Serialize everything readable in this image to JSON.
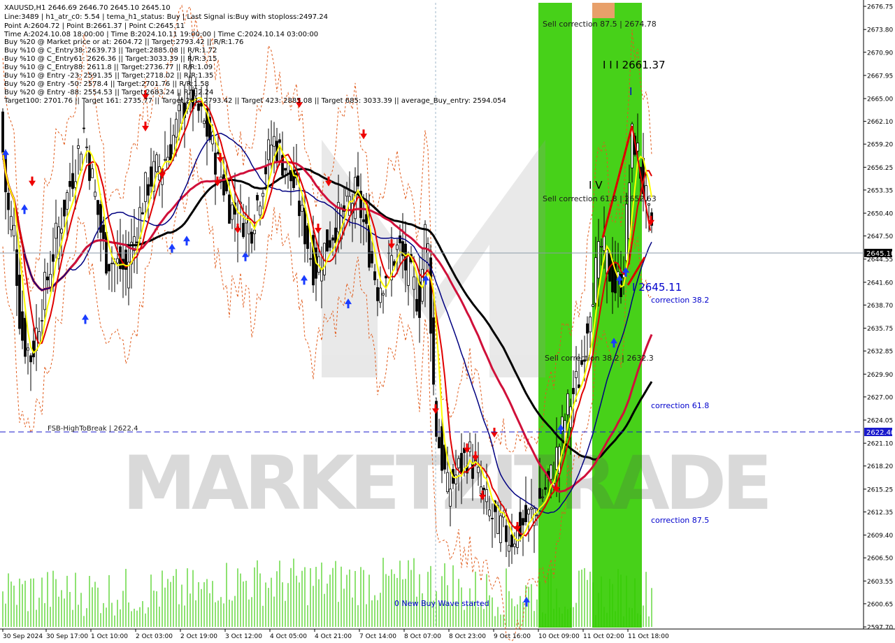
{
  "header": {
    "symbol_line": "XAUUSD,H1  2646.69 2646.70 2645.10 2645.10",
    "info_lines": [
      "Line:3489 | h1_atr_c0: 5.54 | tema_h1_status: Buy | Last Signal is:Buy with stoploss:2497.24",
      "Point A:2604.72 | Point B:2661.37 | Point C:2645.11",
      "Time A:2024.10.08 18:00:00 | Time B:2024.10.11 19:00:00 | Time C:2024.10.14 03:00:00",
      "Buy %20 @ Market price or at: 2604.72 || Target:2793.42 || R/R:1.76",
      "Buy %10 @ C_Entry38: 2639.73 || Target:2885.08 || R/R:1.72",
      "Buy %10 @ C_Entry61: 2626.36 || Target:3033.39 || R/R:3.15",
      "Buy %10 @ C_Entry88: 2611.8 || Target:2736.77 || R/R:1.09",
      "Buy %10 @ Entry -23: 2591.35 || Target:2718.02 || R/R:1.35",
      "Buy %20 @ Entry -50: 2578.4 || Target:2701.76 || R/R:1.58",
      "Buy %20 @ Entry -88: 2554.53 || Target:2683.24 || R/R:2.24",
      "Target100: 2701.76 || Target 161: 2735.77 || Target 261: 2793.42 || Target 423: 2885.08 || Target 685: 3033.39 || average_Buy_entry: 2594.054"
    ]
  },
  "watermark": "MARKETZITRADE",
  "annotations": {
    "sell_875": "Sell correction 87.5 | 2674.78",
    "sell_618": "Sell correction 61.8 | 2652.63",
    "sell_382": "Sell correction 38.2 | 2632.3",
    "point_b": "I I I 2661.37",
    "point_c": "I 2645.11",
    "wave_iv": "I V",
    "wave_i": "I",
    "corr_382": "correction 38.2",
    "corr_618": "correction 61.8",
    "corr_875": "correction 87.5",
    "fsb": "FSB-HighToBreak | 2622.4",
    "new_wave": "0 New Buy Wave started"
  },
  "price_tags": {
    "current": "2645.10",
    "fsb": "2622.40"
  },
  "colors": {
    "green_zone": "#33cc00",
    "orange_box": "#e8a06a",
    "blue_label": "#0000cc",
    "current_tag": "#000000",
    "fsb_tag": "#1a1acc",
    "ma_black": "#000000",
    "ma_crimson": "#d0103a",
    "ma_navy": "#000080",
    "ma_red": "#e00000",
    "ma_yellow": "#ffff00",
    "volume": "#33cc00"
  },
  "chart_data": {
    "type": "candlestick",
    "symbol": "XAUUSD",
    "timeframe": "H1",
    "ylim": [
      2597.7,
      2677.2
    ],
    "y_ticks": [
      "2676.75",
      "2673.80",
      "2670.90",
      "2667.95",
      "2665.00",
      "2662.10",
      "2659.20",
      "2656.25",
      "2653.35",
      "2650.40",
      "2647.50",
      "2644.55",
      "2641.60",
      "2638.70",
      "2635.75",
      "2632.85",
      "2629.90",
      "2627.00",
      "2624.05",
      "2621.10",
      "2618.20",
      "2615.25",
      "2612.35",
      "2609.40",
      "2606.50",
      "2603.55",
      "2600.65",
      "2597.70"
    ],
    "x_ticks": [
      "30 Sep 2024",
      "30 Sep 17:00",
      "1 Oct 10:00",
      "2 Oct 03:00",
      "2 Oct 19:00",
      "3 Oct 12:00",
      "4 Oct 05:00",
      "4 Oct 21:00",
      "7 Oct 14:00",
      "8 Oct 07:00",
      "8 Oct 23:00",
      "9 Oct 16:00",
      "10 Oct 09:00",
      "11 Oct 02:00",
      "11 Oct 18:00"
    ],
    "close_anchors": [
      [
        0,
        2663
      ],
      [
        10,
        2651
      ],
      [
        20,
        2648
      ],
      [
        30,
        2635
      ],
      [
        45,
        2632
      ],
      [
        60,
        2639
      ],
      [
        80,
        2647
      ],
      [
        100,
        2654
      ],
      [
        120,
        2661
      ],
      [
        150,
        2645
      ],
      [
        180,
        2643
      ],
      [
        210,
        2654
      ],
      [
        240,
        2658
      ],
      [
        270,
        2666
      ],
      [
        300,
        2660
      ],
      [
        330,
        2651
      ],
      [
        360,
        2649
      ],
      [
        390,
        2660
      ],
      [
        420,
        2654
      ],
      [
        450,
        2643
      ],
      [
        480,
        2649
      ],
      [
        510,
        2653
      ],
      [
        540,
        2641
      ],
      [
        570,
        2646
      ],
      [
        600,
        2639
      ],
      [
        610,
        2650
      ],
      [
        622,
        2624
      ],
      [
        640,
        2615
      ],
      [
        670,
        2620
      ],
      [
        700,
        2612
      ],
      [
        730,
        2609
      ],
      [
        760,
        2612
      ],
      [
        790,
        2617
      ],
      [
        810,
        2625
      ],
      [
        830,
        2630
      ],
      [
        845,
        2640
      ],
      [
        860,
        2646
      ],
      [
        880,
        2641
      ],
      [
        890,
        2642
      ],
      [
        905,
        2661
      ],
      [
        920,
        2654
      ],
      [
        935,
        2645
      ]
    ],
    "current_price": 2645.1,
    "fsb_level": 2622.4,
    "levels": {
      "point_a": 2604.72,
      "point_b": 2661.37,
      "point_c": 2645.11
    }
  }
}
